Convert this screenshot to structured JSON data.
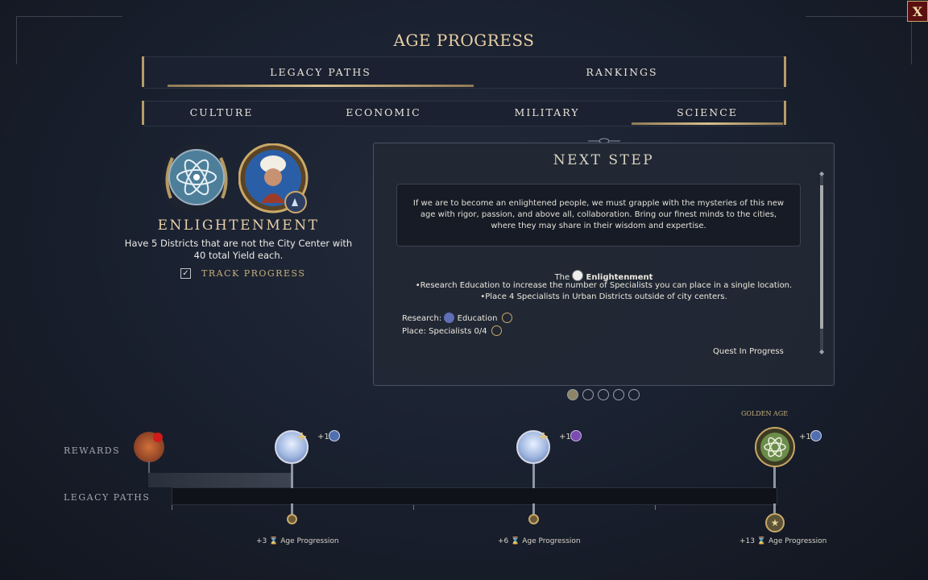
{
  "window": {
    "title": "AGE PROGRESS",
    "close_label": "X"
  },
  "main_tabs": [
    {
      "label": "LEGACY PATHS",
      "active": true
    },
    {
      "label": "RANKINGS",
      "active": false
    }
  ],
  "path_tabs": [
    {
      "label": "CULTURE",
      "active": false
    },
    {
      "label": "ECONOMIC",
      "active": false
    },
    {
      "label": "MILITARY",
      "active": false
    },
    {
      "label": "SCIENCE",
      "active": true
    }
  ],
  "milestone": {
    "name": "ENLIGHTENMENT",
    "description": "Have 5 Districts that are not the City Center with 40 total Yield each.",
    "track_label": "TRACK PROGRESS",
    "track_checked": true,
    "icon": "atom-laurel-icon",
    "portrait": "leader-portrait-icon"
  },
  "next_step": {
    "title": "NEXT STEP",
    "flavor": "If we are to become an enlightened people, we must grapple with the mysteries of this new age with rigor, passion, and above all, collaboration. Bring our finest minds to the cities, where they may share in their wisdom and expertise.",
    "heading_prefix": "The",
    "heading_name": "Enlightenment",
    "bullets": [
      "•Research Education to increase the number of Specialists you can place in a single location.",
      "•Place 4 Specialists in Urban Districts outside of city centers."
    ],
    "requirements": [
      {
        "label": "Research:",
        "value": "Education"
      },
      {
        "label": "Place:",
        "value": "Specialists 0/4"
      }
    ],
    "status": "Quest In Progress",
    "pager": {
      "total": 5,
      "current": 1
    }
  },
  "timeline": {
    "rewards_label": "REWARDS",
    "paths_label": "LEGACY PATHS",
    "golden_age_label": "GOLDEN AGE",
    "rewards": [
      {
        "bonus": "+1",
        "icon": "science-yield-icon"
      },
      {
        "bonus": "+1",
        "icon": "happiness-yield-icon"
      },
      {
        "bonus": "+1",
        "icon": "science-yield-icon"
      }
    ],
    "progression_label": "Age Progression",
    "milestones": [
      {
        "value": "+3"
      },
      {
        "value": "+6"
      },
      {
        "value": "+13"
      }
    ]
  },
  "colors": {
    "gold": "#c9a86a",
    "panel": "#222834",
    "accent_red": "#5a1010"
  }
}
